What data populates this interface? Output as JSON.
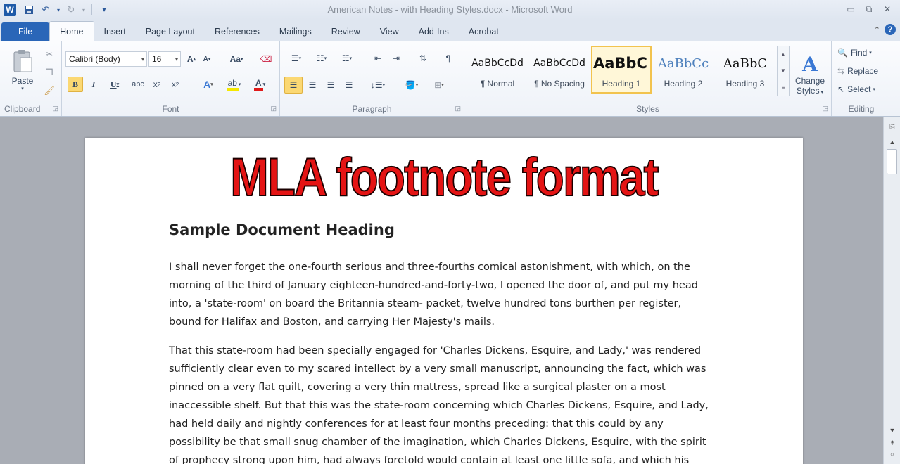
{
  "window": {
    "title": "American Notes - with Heading Styles.docx  -  Microsoft Word",
    "app_icon_letter": "W"
  },
  "tabs": [
    {
      "label": "File"
    },
    {
      "label": "Home"
    },
    {
      "label": "Insert"
    },
    {
      "label": "Page Layout"
    },
    {
      "label": "References"
    },
    {
      "label": "Mailings"
    },
    {
      "label": "Review"
    },
    {
      "label": "View"
    },
    {
      "label": "Add-Ins"
    },
    {
      "label": "Acrobat"
    }
  ],
  "ribbon": {
    "clipboard": {
      "paste_label": "Paste",
      "group_label": "Clipboard"
    },
    "font": {
      "font_name": "Calibri (Body)",
      "font_size": "16",
      "group_label": "Font"
    },
    "paragraph": {
      "group_label": "Paragraph"
    },
    "styles": {
      "group_label": "Styles",
      "items": [
        {
          "sample": "AaBbCcDd",
          "name": "¶ Normal"
        },
        {
          "sample": "AaBbCcDd",
          "name": "¶ No Spacing"
        },
        {
          "sample": "AaBbC",
          "name": "Heading 1"
        },
        {
          "sample": "AaBbCc",
          "name": "Heading 2"
        },
        {
          "sample": "AaBbC",
          "name": "Heading 3"
        }
      ],
      "change_styles_label_1": "Change",
      "change_styles_label_2": "Styles"
    },
    "editing": {
      "find_label": "Find",
      "replace_label": "Replace",
      "select_label": "Select",
      "group_label": "Editing"
    }
  },
  "overlay_title": "MLA footnote format",
  "document": {
    "heading": "Sample Document Heading",
    "paragraph1_lines": [
      "I shall never forget the one-fourth serious and three-fourths comical astonishment, with which, on the",
      "morning of the third of January eighteen-hundred-and-forty-two,  I opened the door of, and put my head",
      "into, a 'state-room' on board the Britannia steam- packet, twelve hundred tons burthen per register,",
      "bound for Halifax and Boston, and carrying Her Majesty's mails."
    ],
    "paragraph2_lines": [
      "That this state-room had been specially engaged for 'Charles Dickens, Esquire, and Lady,' was rendered",
      "sufficiently clear even to my scared intellect by a very small manuscript, announcing the fact, which was",
      "pinned on a very flat quilt, covering a very thin mattress, spread like a surgical plaster on a most",
      "inaccessible shelf. But that this was the state-room concerning which Charles Dickens, Esquire, and Lady,",
      "had held daily and nightly conferences for at least four months preceding: that this could by any",
      "possibility be that small snug chamber of the imagination, which Charles Dickens, Esquire, with the spirit",
      "of prophecy strong upon him, had always foretold would contain at least one little sofa, and which his"
    ]
  },
  "colors": {
    "overlay_red": "#e41414",
    "file_tab_blue": "#2a66b8",
    "selected_style": "#f2c34e"
  }
}
